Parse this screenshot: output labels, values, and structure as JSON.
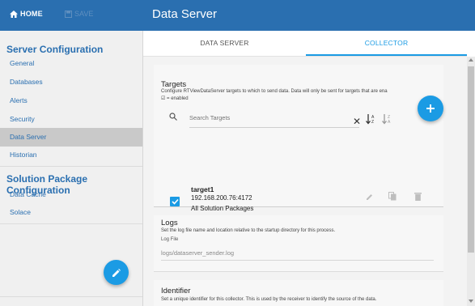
{
  "topbar": {
    "home_label": "HOME",
    "save_label": "SAVE",
    "title": "Data Server"
  },
  "sidebar": {
    "section1_title": "Server Configuration",
    "items": [
      {
        "label": "General"
      },
      {
        "label": "Databases"
      },
      {
        "label": "Alerts"
      },
      {
        "label": "Security"
      },
      {
        "label": "Data Server"
      },
      {
        "label": "Historian"
      }
    ],
    "section2_title": "Solution Package Configuration",
    "items2": [
      {
        "label": "Data Cache"
      },
      {
        "label": "Solace"
      }
    ]
  },
  "tabs": [
    {
      "label": "DATA SERVER"
    },
    {
      "label": "COLLECTOR"
    }
  ],
  "targets": {
    "title": "Targets",
    "description": "Configure RTViewDataServer targets to which to send data. Data will only be sent for targets that are ena",
    "legend": "☑ = enabled",
    "search_placeholder": "Search Targets",
    "items": [
      {
        "name": "target1",
        "host": "192.168.200.76:4172",
        "packages": "All Solution Packages"
      }
    ]
  },
  "logs": {
    "title": "Logs",
    "description": "Set the log file name and location relative to the startup directory for this process.",
    "field_label": "Log File",
    "field_value": "logs/dataserver_sender.log"
  },
  "identifier": {
    "title": "Identifier",
    "description": "Set a unique identifier for this collector. This is used by the receiver to identify the source of the data."
  },
  "colors": {
    "brand": "#2a6fb0",
    "accent": "#1b9be4",
    "sidebar_active": "#c9c9c9"
  },
  "icons": [
    "home-icon",
    "save-icon",
    "edit-icon",
    "add-icon",
    "search-icon",
    "clear-icon",
    "sort-az-icon",
    "sort-za-icon",
    "checkbox-checked-icon",
    "pencil-icon",
    "copy-icon",
    "trash-icon"
  ]
}
